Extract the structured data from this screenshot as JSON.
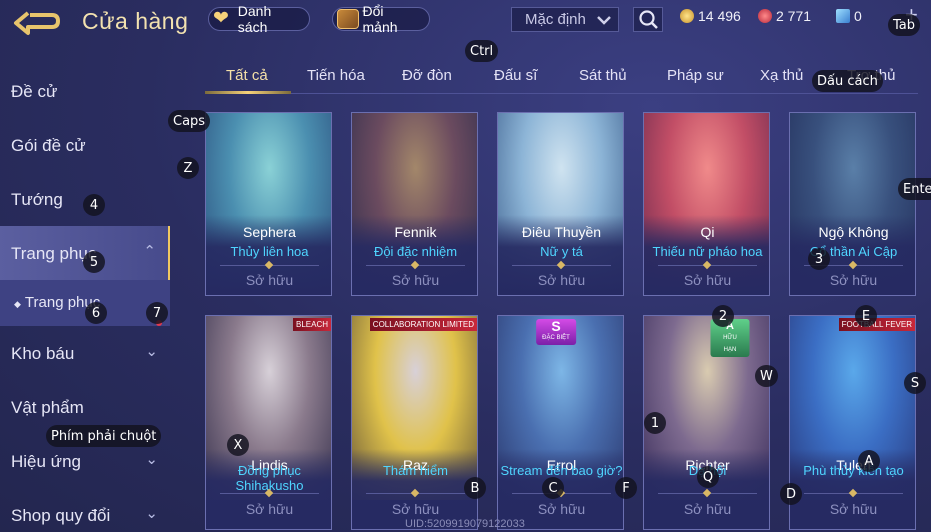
{
  "header": {
    "title": "Cửa hàng",
    "list_label": "Danh sách",
    "exchange_label": "Đổi mảnh",
    "sort_value": "Mặc định",
    "gold": "14 496",
    "gems": "2 771",
    "vouchers": "0"
  },
  "sidebar": {
    "items": [
      {
        "label": "Đề cử"
      },
      {
        "label": "Gói đề cử"
      },
      {
        "label": "Tướng"
      },
      {
        "label": "Trang phục"
      },
      {
        "label": "Trang phục"
      },
      {
        "label": "Kho báu"
      },
      {
        "label": "Vật phẩm"
      },
      {
        "label": "Hiệu ứng"
      },
      {
        "label": "Shop quy đổi"
      }
    ]
  },
  "tabs": [
    "Tất cả",
    "Tiến hóa",
    "Đỡ đòn",
    "Đấu sĩ",
    "Sát thủ",
    "Pháp sư",
    "Xạ thủ",
    "Trợ thủ"
  ],
  "cards": [
    {
      "hero": "Sephera",
      "skin": "Thủy liên hoa",
      "status": "Sở hữu",
      "colors": [
        "#8ad1d6",
        "#4b8fb0",
        "#2b4e7d"
      ]
    },
    {
      "hero": "Fennik",
      "skin": "Đội đặc nhiệm",
      "status": "Sở hữu",
      "colors": [
        "#a3876a",
        "#6b4b5f",
        "#2f2e4d"
      ]
    },
    {
      "hero": "Điêu Thuyền",
      "skin": "Nữ y tá",
      "status": "Sở hữu",
      "colors": [
        "#cfe3f0",
        "#8cb4d6",
        "#3c5e8c"
      ]
    },
    {
      "hero": "Qi",
      "skin": "Thiếu nữ pháo hoa",
      "status": "Sở hữu",
      "colors": [
        "#f08a8a",
        "#c24e66",
        "#6b2a4e"
      ]
    },
    {
      "hero": "Ngộ Không",
      "skin": "Cổ thần Ai Cập",
      "status": "Sở hữu",
      "colors": [
        "#5a7fa8",
        "#38507d",
        "#24305c"
      ]
    },
    {
      "hero": "Lindis",
      "skin": "Đồng phục Shihakusho",
      "status": "Sở hữu",
      "colors": [
        "#d7d0d8",
        "#8a7a8c",
        "#3a3450"
      ],
      "banner": "BLEACH"
    },
    {
      "hero": "Raz",
      "skin": "Thám hiểm",
      "status": "Sở hữu",
      "colors": [
        "#d8d0d8",
        "#e0c24a",
        "#6a5a3a"
      ],
      "banner": "COLLABORATION LIMITED"
    },
    {
      "hero": "Errol",
      "skin": "Stream đến bao giờ?",
      "status": "Sở hữu",
      "colors": [
        "#7db6e6",
        "#4a6fb0",
        "#2c3a70"
      ],
      "badge": "S",
      "badge_sub": "ĐẶC BIỆT"
    },
    {
      "hero": "Richter",
      "skin": "Dạ hội",
      "status": "Sở hữu",
      "colors": [
        "#d9cbb0",
        "#7d6a8f",
        "#3c2f5c"
      ],
      "badge": "A",
      "badge_sub": "HỮU HẠN"
    },
    {
      "hero": "Tulen",
      "skin": "Phù thủy kiến tạo",
      "status": "Sở hữu",
      "colors": [
        "#5aa8ea",
        "#3b6ec4",
        "#2a3c80"
      ],
      "banner": "FOOTBALL FEVER"
    }
  ],
  "uid": "UID:5209919079122033",
  "keys": {
    "tab": "Tab",
    "ctrl": "Ctrl",
    "space": "Dấu cách",
    "caps": "Caps",
    "enter": "Enter",
    "rmb": "Phím phải chuột",
    "z": "Z",
    "x": "X",
    "c": "C",
    "b": "B",
    "f": "F",
    "q": "Q",
    "d": "D",
    "a": "A",
    "s": "S",
    "w": "W",
    "e": "E",
    "k1": "1",
    "k2": "2",
    "k3": "3",
    "k4": "4",
    "k5": "5",
    "k6": "6",
    "k7": "7"
  }
}
